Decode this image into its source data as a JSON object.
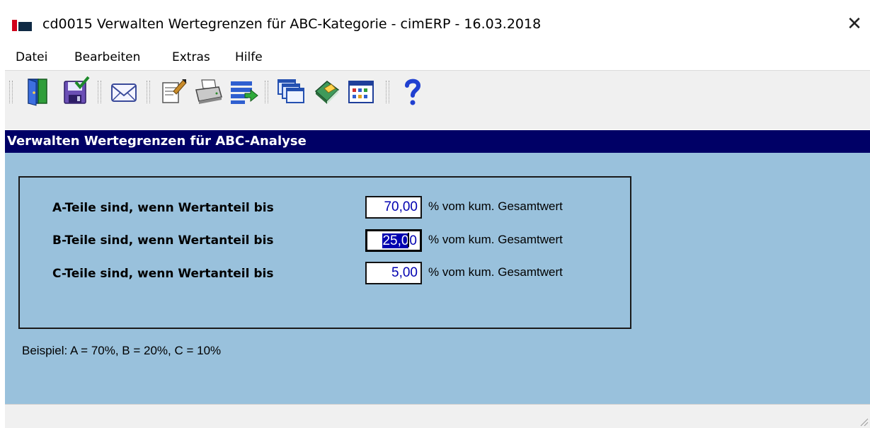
{
  "window": {
    "title": "cd0015 Verwalten Wertegrenzen für ABC-Kategorie - cimERP - 16.03.2018",
    "close_glyph": "✕"
  },
  "menu": {
    "items": [
      {
        "label": "Datei"
      },
      {
        "label": "Bearbeiten"
      },
      {
        "label": "Extras"
      },
      {
        "label": "Hilfe"
      }
    ]
  },
  "toolbar": {
    "buttons": [
      {
        "icon": "exit-door-icon"
      },
      {
        "icon": "save-icon"
      },
      {
        "icon": "mail-icon"
      },
      {
        "icon": "edit-notes-icon"
      },
      {
        "icon": "print-icon"
      },
      {
        "icon": "list-export-icon"
      },
      {
        "icon": "windows-icon"
      },
      {
        "icon": "book-icon"
      },
      {
        "icon": "calendar-icon"
      },
      {
        "icon": "help-icon"
      }
    ]
  },
  "header": {
    "title": "Verwalten Wertegrenzen für ABC-Analyse"
  },
  "form": {
    "rows": [
      {
        "label": "A-Teile sind, wenn Wertanteil bis",
        "value": "70,00",
        "unit": "% vom kum. Gesamtwert"
      },
      {
        "label": "B-Teile sind, wenn Wertanteil bis",
        "value": "25,00",
        "value_selected": "25,0",
        "value_rest": "0",
        "unit": "% vom kum. Gesamtwert"
      },
      {
        "label": "C-Teile sind, wenn Wertanteil bis",
        "value": "5,00",
        "unit": "% vom kum. Gesamtwert"
      }
    ],
    "example": "Beispiel: A = 70%, B = 20%, C = 10%"
  },
  "colors": {
    "header_bg": "#000066",
    "content_bg": "#99c1dc",
    "input_text": "#0000b0",
    "selection_bg": "#0000b0",
    "logo_red": "#d0001b"
  }
}
